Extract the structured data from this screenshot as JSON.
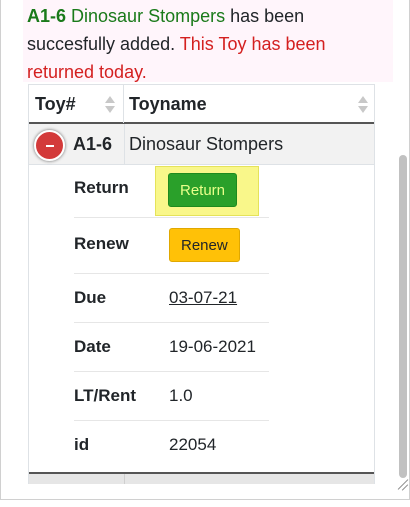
{
  "alert": {
    "toy_code": "A1-6",
    "toy_name": "Dinosaur Stompers",
    "added_text": "has been succesfully added.",
    "returned_text": "This Toy has been returned today."
  },
  "table": {
    "headers": [
      "Toy#",
      "Toyname"
    ],
    "row": {
      "toy_id": "A1-6",
      "toy_name": "Dinosaur Stompers"
    }
  },
  "details": {
    "return_label": "Return",
    "return_button": "Return",
    "renew_label": "Renew",
    "renew_button": "Renew",
    "due_label": "Due",
    "due_value": "03-07-21",
    "date_label": "Date",
    "date_value": "19-06-2021",
    "lt_rent_label": "LT/Rent",
    "lt_rent_value": "1.0",
    "id_label": "id",
    "id_value": "22054"
  },
  "colors": {
    "success_text": "#1a7a1a",
    "danger_text": "#d42020",
    "return_button_bg": "#2aa02a",
    "renew_button_bg": "#ffc107",
    "highlight": "#f9f78a"
  },
  "icons": [
    "sort-icon",
    "collapse-row-icon",
    "resize-grip-icon"
  ]
}
